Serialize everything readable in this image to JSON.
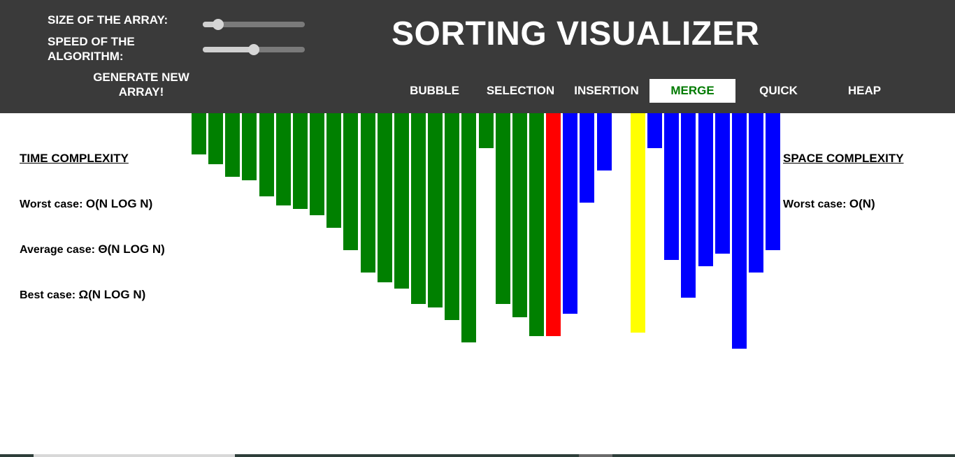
{
  "header": {
    "size_label": "SIZE OF THE ARRAY:",
    "speed_label": "SPEED OF THE ALGORITHM:",
    "generate_label": "GENERATE NEW ARRAY!",
    "title": "SORTING VISUALIZER"
  },
  "sliders": {
    "size_value_fraction": 0.15,
    "speed_value_fraction": 0.5
  },
  "nav": {
    "active": "MERGE",
    "tabs": [
      "BUBBLE",
      "SELECTION",
      "INSERTION",
      "MERGE",
      "QUICK",
      "HEAP"
    ]
  },
  "time_complexity": {
    "heading": "TIME COMPLEXITY",
    "worst_label": "Worst case:",
    "worst_value": "O(N LOG N)",
    "average_label": "Average case:",
    "average_value": "Θ(N LOG N)",
    "best_label": "Best case:",
    "best_value": "Ω(N LOG N)"
  },
  "space_complexity": {
    "heading": "SPACE COMPLEXITY",
    "worst_label": "Worst case:",
    "worst_value": "O(N)"
  },
  "colors": {
    "header_bg": "#3a3a3a",
    "sorted": "#008000",
    "unsorted": "#0000ff",
    "compare": "#ff0000",
    "current": "#ffff00",
    "active_tab_text": "#007a00"
  },
  "chart_data": {
    "type": "bar",
    "values": [
      59,
      73,
      91,
      96,
      119,
      132,
      137,
      146,
      164,
      196,
      228,
      242,
      251,
      273,
      278,
      296,
      328,
      50,
      273,
      292,
      319,
      319,
      287,
      128,
      82,
      0,
      314,
      50,
      210,
      264,
      219,
      201,
      337,
      228,
      196
    ],
    "states": [
      "sorted",
      "sorted",
      "sorted",
      "sorted",
      "sorted",
      "sorted",
      "sorted",
      "sorted",
      "sorted",
      "sorted",
      "sorted",
      "sorted",
      "sorted",
      "sorted",
      "sorted",
      "sorted",
      "sorted",
      "sorted",
      "sorted",
      "sorted",
      "sorted",
      "compare",
      "unsorted",
      "unsorted",
      "unsorted",
      "unsorted",
      "current",
      "unsorted",
      "unsorted",
      "unsorted",
      "unsorted",
      "unsorted",
      "unsorted",
      "unsorted",
      "unsorted"
    ]
  }
}
